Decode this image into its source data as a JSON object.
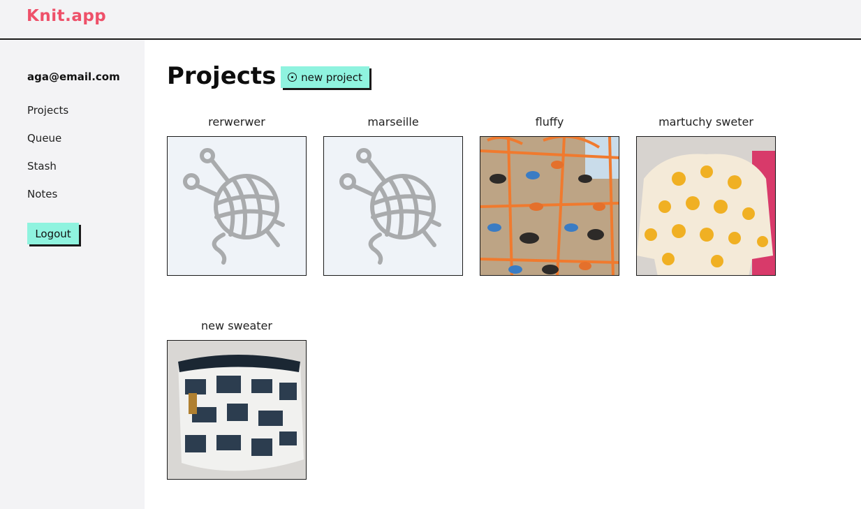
{
  "app": {
    "logo": "Knit.app"
  },
  "sidebar": {
    "user_email": "aga@email.com",
    "nav": [
      {
        "label": "Projects"
      },
      {
        "label": "Queue"
      },
      {
        "label": "Stash"
      },
      {
        "label": "Notes"
      }
    ],
    "logout_label": "Logout"
  },
  "main": {
    "title": "Projects",
    "new_project_label": "new project",
    "projects": [
      {
        "name": "rerwerwer",
        "image": "yarn-placeholder-icon"
      },
      {
        "name": "marseille",
        "image": "yarn-placeholder-icon"
      },
      {
        "name": "fluffy",
        "image": "dinosaur-fabric-photo"
      },
      {
        "name": "martuchy sweter",
        "image": "orange-sweater-photo"
      },
      {
        "name": "new sweater",
        "image": "project-bag-photo"
      }
    ]
  },
  "colors": {
    "accent": "#8ff3df",
    "logo": "#ee5069",
    "sidebar_bg": "#f3f3f5"
  }
}
